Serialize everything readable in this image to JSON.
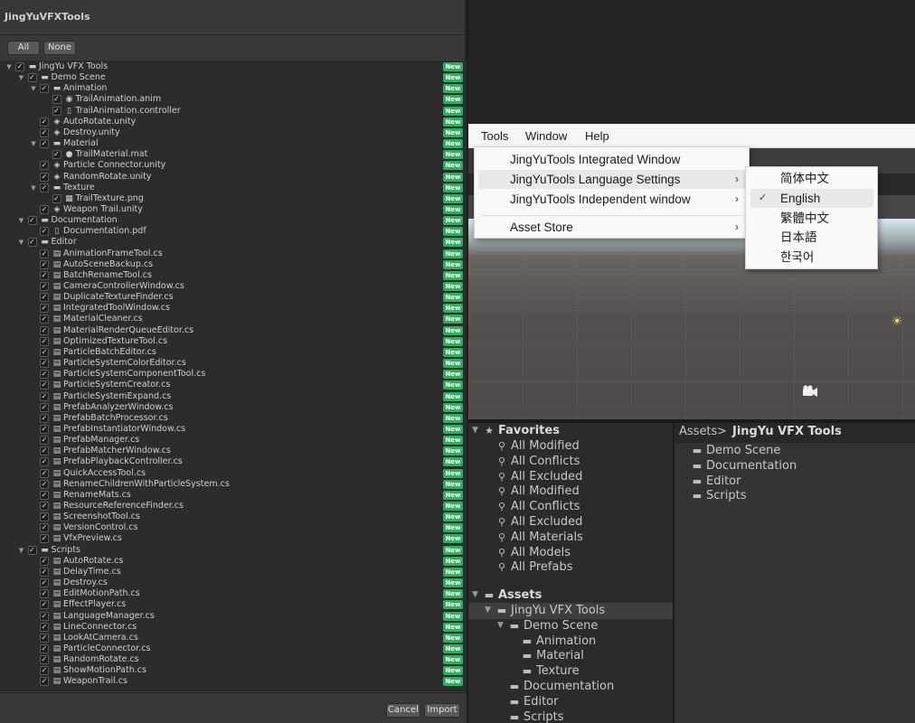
{
  "import_window": {
    "title": "JingYuVFXTools",
    "buttons": {
      "all": "All",
      "none": "None",
      "cancel": "Cancel",
      "import": "Import"
    },
    "new_badge": "New",
    "tree": [
      {
        "name": "JingYu VFX Tools",
        "depth": 0,
        "type": "folder",
        "expanded": true
      },
      {
        "name": "Demo Scene",
        "depth": 1,
        "type": "folder",
        "expanded": true
      },
      {
        "name": "Animation",
        "depth": 2,
        "type": "folder",
        "expanded": true
      },
      {
        "name": "TrailAnimation.anim",
        "depth": 3,
        "type": "anim"
      },
      {
        "name": "TrailAnimation.controller",
        "depth": 3,
        "type": "doc"
      },
      {
        "name": "AutoRotate.unity",
        "depth": 2,
        "type": "unity"
      },
      {
        "name": "Destroy.unity",
        "depth": 2,
        "type": "unity"
      },
      {
        "name": "Material",
        "depth": 2,
        "type": "folder",
        "expanded": true
      },
      {
        "name": "TrailMaterial.mat",
        "depth": 3,
        "type": "mat"
      },
      {
        "name": "Particle Connector.unity",
        "depth": 2,
        "type": "unity"
      },
      {
        "name": "RandomRotate.unity",
        "depth": 2,
        "type": "unity"
      },
      {
        "name": "Texture",
        "depth": 2,
        "type": "folder",
        "expanded": true
      },
      {
        "name": "TrailTexture.png",
        "depth": 3,
        "type": "png"
      },
      {
        "name": "Weapon Trail.unity",
        "depth": 2,
        "type": "unity"
      },
      {
        "name": "Documentation",
        "depth": 1,
        "type": "folder",
        "expanded": true
      },
      {
        "name": "Documentation.pdf",
        "depth": 2,
        "type": "doc"
      },
      {
        "name": "Editor",
        "depth": 1,
        "type": "folder",
        "expanded": true
      },
      {
        "name": "AnimationFrameTool.cs",
        "depth": 2,
        "type": "cs"
      },
      {
        "name": "AutoSceneBackup.cs",
        "depth": 2,
        "type": "cs"
      },
      {
        "name": "BatchRenameTool.cs",
        "depth": 2,
        "type": "cs"
      },
      {
        "name": "CameraControllerWindow.cs",
        "depth": 2,
        "type": "cs"
      },
      {
        "name": "DuplicateTextureFinder.cs",
        "depth": 2,
        "type": "cs"
      },
      {
        "name": "IntegratedToolWindow.cs",
        "depth": 2,
        "type": "cs"
      },
      {
        "name": "MaterialCleaner.cs",
        "depth": 2,
        "type": "cs"
      },
      {
        "name": "MaterialRenderQueueEditor.cs",
        "depth": 2,
        "type": "cs"
      },
      {
        "name": "OptimizedTextureTool.cs",
        "depth": 2,
        "type": "cs"
      },
      {
        "name": "ParticleBatchEditor.cs",
        "depth": 2,
        "type": "cs"
      },
      {
        "name": "ParticleSystemColorEditor.cs",
        "depth": 2,
        "type": "cs"
      },
      {
        "name": "ParticleSystemComponentTool.cs",
        "depth": 2,
        "type": "cs"
      },
      {
        "name": "ParticleSystemCreator.cs",
        "depth": 2,
        "type": "cs"
      },
      {
        "name": "ParticleSystemExpand.cs",
        "depth": 2,
        "type": "cs"
      },
      {
        "name": "PrefabAnalyzerWindow.cs",
        "depth": 2,
        "type": "cs"
      },
      {
        "name": "PrefabBatchProcessor.cs",
        "depth": 2,
        "type": "cs"
      },
      {
        "name": "PrefabInstantiatorWindow.cs",
        "depth": 2,
        "type": "cs"
      },
      {
        "name": "PrefabManager.cs",
        "depth": 2,
        "type": "cs"
      },
      {
        "name": "PrefabMatcherWindow.cs",
        "depth": 2,
        "type": "cs"
      },
      {
        "name": "PrefabPlaybackController.cs",
        "depth": 2,
        "type": "cs"
      },
      {
        "name": "QuickAccessTool.cs",
        "depth": 2,
        "type": "cs"
      },
      {
        "name": "RenameChildrenWithParticleSystem.cs",
        "depth": 2,
        "type": "cs"
      },
      {
        "name": "RenameMats.cs",
        "depth": 2,
        "type": "cs"
      },
      {
        "name": "ResourceReferenceFinder.cs",
        "depth": 2,
        "type": "cs"
      },
      {
        "name": "ScreenshotTool.cs",
        "depth": 2,
        "type": "cs"
      },
      {
        "name": "VersionControl.cs",
        "depth": 2,
        "type": "cs"
      },
      {
        "name": "VfxPreview.cs",
        "depth": 2,
        "type": "cs"
      },
      {
        "name": "Scripts",
        "depth": 1,
        "type": "folder",
        "expanded": true
      },
      {
        "name": "AutoRotate.cs",
        "depth": 2,
        "type": "cs"
      },
      {
        "name": "DelayTime.cs",
        "depth": 2,
        "type": "cs"
      },
      {
        "name": "Destroy.cs",
        "depth": 2,
        "type": "cs"
      },
      {
        "name": "EditMotionPath.cs",
        "depth": 2,
        "type": "cs"
      },
      {
        "name": "EffectPlayer.cs",
        "depth": 2,
        "type": "cs"
      },
      {
        "name": "LanguageManager.cs",
        "depth": 2,
        "type": "cs"
      },
      {
        "name": "LineConnector.cs",
        "depth": 2,
        "type": "cs"
      },
      {
        "name": "LookAtCamera.cs",
        "depth": 2,
        "type": "cs"
      },
      {
        "name": "ParticleConnector.cs",
        "depth": 2,
        "type": "cs"
      },
      {
        "name": "RandomRotate.cs",
        "depth": 2,
        "type": "cs"
      },
      {
        "name": "ShowMotionPath.cs",
        "depth": 2,
        "type": "cs"
      },
      {
        "name": "WeaponTrail.cs",
        "depth": 2,
        "type": "cs"
      }
    ]
  },
  "menubar": {
    "items": [
      "Tools",
      "Window",
      "Help"
    ]
  },
  "tools_menu": {
    "items": [
      {
        "label": "JingYuTools Integrated Window",
        "submenu": false
      },
      {
        "label": "JingYuTools Language Settings",
        "submenu": true,
        "highlighted": true
      },
      {
        "label": "JingYuTools Independent window",
        "submenu": true
      },
      {
        "label": "Asset Store",
        "submenu": true
      }
    ]
  },
  "language_menu": {
    "items": [
      {
        "label": "简体中文",
        "checked": false
      },
      {
        "label": "English",
        "checked": true
      },
      {
        "label": "繁體中文",
        "checked": false
      },
      {
        "label": "日本語",
        "checked": false
      },
      {
        "label": "한국어",
        "checked": false
      }
    ]
  },
  "project": {
    "favorites_label": "Favorites",
    "favorites": [
      "All Modified",
      "All Conflicts",
      "All Excluded",
      "All Modified",
      "All Conflicts",
      "All Excluded",
      "All Materials",
      "All Models",
      "All Prefabs"
    ],
    "assets_label": "Assets",
    "assets_tree": [
      {
        "name": "JingYu VFX Tools",
        "depth": 1,
        "selected": true
      },
      {
        "name": "Demo Scene",
        "depth": 2
      },
      {
        "name": "Animation",
        "depth": 3
      },
      {
        "name": "Material",
        "depth": 3
      },
      {
        "name": "Texture",
        "depth": 3
      },
      {
        "name": "Documentation",
        "depth": 2
      },
      {
        "name": "Editor",
        "depth": 2
      },
      {
        "name": "Scripts",
        "depth": 2
      }
    ],
    "breadcrumb_root": "Assets",
    "breadcrumb_sep": ">",
    "breadcrumb_current": "JingYu VFX Tools",
    "contents": [
      "Demo Scene",
      "Documentation",
      "Editor",
      "Scripts"
    ]
  },
  "colors": {
    "new_badge": "#2bb15d",
    "menu_bg": "#f9f9f9",
    "panel_bg": "#2b2b2b"
  }
}
